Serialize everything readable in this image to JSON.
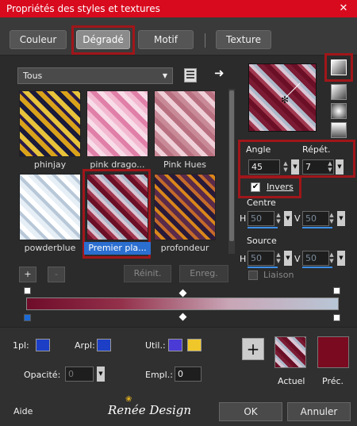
{
  "window": {
    "title": "Propriétés des styles et textures",
    "close": "✕"
  },
  "tabs": [
    {
      "label": "Couleur"
    },
    {
      "label": "Dégradé"
    },
    {
      "label": "Motif"
    },
    {
      "label": "Texture"
    }
  ],
  "library": {
    "category": "Tous",
    "items": [
      {
        "label": "phinjay"
      },
      {
        "label": "pink drago..."
      },
      {
        "label": "Pink Hues"
      },
      {
        "label": "powderblue"
      },
      {
        "label": "Premier pla..."
      },
      {
        "label": "profondeur"
      }
    ],
    "add_label": "+",
    "remove_label": "-",
    "reset_label": "Réinit.",
    "save_label": "Enreg."
  },
  "gradient": {
    "angle_label": "Angle",
    "angle_value": "45",
    "repeat_label": "Répét.",
    "repeat_value": "7",
    "invert_label": "Invers",
    "invert_checked": true,
    "center_label": "Centre",
    "center_h": "50",
    "center_v": "50",
    "source_label": "Source",
    "source_h": "50",
    "source_v": "50",
    "h_label": "H",
    "v_label": "V",
    "link_label": "Liaison"
  },
  "stops": {
    "first_label": "1pl:",
    "arpl_label": "Arpl:",
    "util_label": "Util.:",
    "opacity_label": "Opacité:",
    "opacity_value": "0",
    "empl_label": "Empl.:",
    "empl_value": "0"
  },
  "colors": {
    "util_a": "#4a3ad6",
    "util_b": "#f0c72a",
    "prev": "#7a0a20"
  },
  "compare": {
    "add_label": "+",
    "current_label": "Actuel",
    "previous_label": "Préc."
  },
  "footer": {
    "help_label": "Aide",
    "brand": "Renée Design",
    "ok_label": "OK",
    "cancel_label": "Annuler"
  }
}
